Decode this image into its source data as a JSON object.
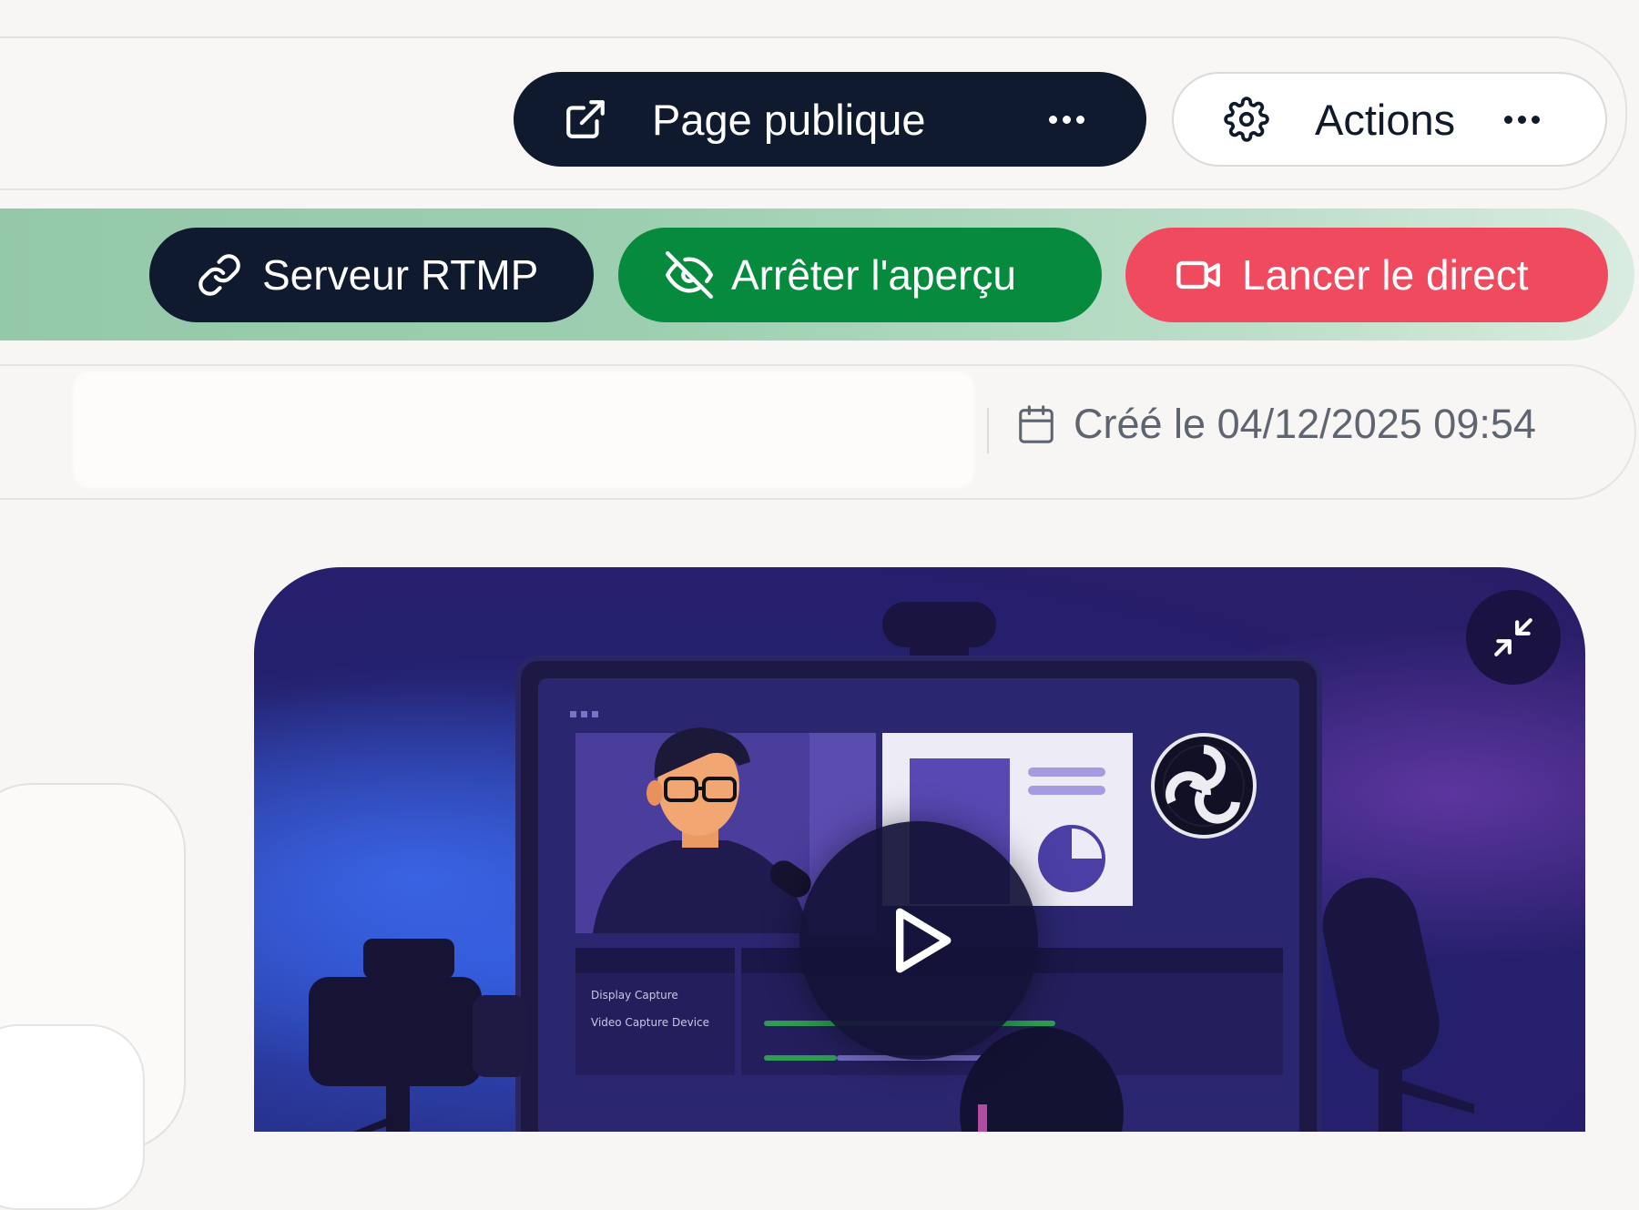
{
  "header": {
    "public_page_button": {
      "label": "Page publique",
      "icon": "external-link-icon",
      "menu_icon": "more-dots-icon"
    },
    "actions_button": {
      "label": "Actions",
      "icon": "gear-icon",
      "menu_icon": "more-dots-icon"
    }
  },
  "stream_controls": {
    "rtmp_button": {
      "label": "Serveur RTMP",
      "icon": "link-icon",
      "color": "#0f1a2e"
    },
    "preview_button": {
      "label": "Arrêter l'aperçu",
      "icon": "eye-off-icon",
      "color": "#058a3e"
    },
    "live_button": {
      "label": "Lancer le direct",
      "icon": "video-camera-icon",
      "color": "#ef4a5e"
    }
  },
  "meta": {
    "created": "Créé le 04/12/2025 09:54",
    "created_icon": "calendar-icon"
  },
  "video": {
    "collapse_icon": "collapse-arrows-icon",
    "play_icon": "play-icon",
    "obs_logo": "obs-logo",
    "panel_labels": [
      "Display Capture",
      "Video Capture Device"
    ]
  },
  "colors": {
    "dark_navy": "#0f1a2e",
    "green": "#058a3e",
    "red": "#ef4a5e",
    "strip_green": "#9ccfb0"
  }
}
